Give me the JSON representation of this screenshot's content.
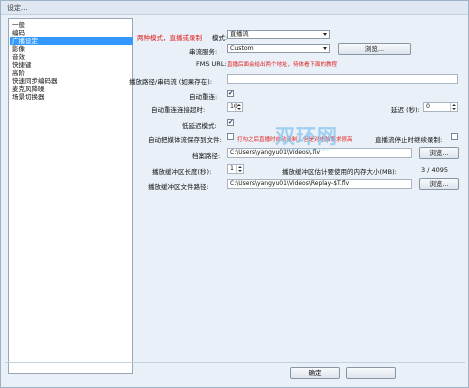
{
  "window": {
    "title": "设定..."
  },
  "sidebar": {
    "items": [
      {
        "label": "一般",
        "selected": false
      },
      {
        "label": "编码",
        "selected": false
      },
      {
        "label": "广播设定",
        "selected": true
      },
      {
        "label": "影像",
        "selected": false
      },
      {
        "label": "音效",
        "selected": false
      },
      {
        "label": "快捷键",
        "selected": false
      },
      {
        "label": "高阶",
        "selected": false
      },
      {
        "label": "快速同步编码器",
        "selected": false
      },
      {
        "label": "麦克风降噪",
        "selected": false
      },
      {
        "label": "场景切换器",
        "selected": false
      }
    ]
  },
  "broadcast": {
    "mode_label": "模式:",
    "mode_note": "两种模式，直播或录制",
    "mode_value": "直播流",
    "service_label": "串流服务:",
    "service_value": "Custom",
    "browse_button": "浏览...",
    "fms_url_label": "FMS URL:",
    "fms_url_note": "直播后面会给出两个地址，待体看下面的教程",
    "fms_url_value": "",
    "stream_key_label": "播放路径/串码流 (如果存在):",
    "stream_key_value": "",
    "auto_reconnect_label": "自动重连:",
    "auto_reconnect_checked": true,
    "reconnect_timeout_label": "自动重连连接超时:",
    "reconnect_timeout_value": "10",
    "delay_label": "延迟 (秒):",
    "delay_value": "0",
    "low_latency_label": "低延迟模式:",
    "low_latency_checked": true,
    "auto_save_label": "自动把媒体流保存到文件:",
    "auto_save_note": "打勾之后直播时自动录制，但是对电脑要求很高",
    "auto_save_checked": false,
    "keep_recording_label": "直播流停止时继续录制:",
    "keep_recording_checked": false,
    "file_path_label": "档案路径:",
    "file_path_value": "C:\\Users\\yangyu01\\Videos\\.flv",
    "browse_button_2": "浏览...",
    "replay_length_label": "播放缓冲区长度(秒):",
    "replay_length_value": "1",
    "replay_memory_label": "播放缓冲区估计要使用的内存大小(MB):",
    "replay_memory_value": "3 / 4095",
    "replay_path_label": "播放缓冲区文件路径:",
    "replay_path_value": "C:\\Users\\yangyu01\\Videos\\Replay-$T.flv",
    "browse_button_3": "浏览..."
  },
  "footer": {
    "ok_button": "确定",
    "cancel_button": ""
  },
  "watermark": {
    "text": "双环网",
    "sub": "www.shuangz.com"
  },
  "colors": {
    "selected": "#3399ff",
    "note_red": "#e02020",
    "watermark": "#86c4f0"
  }
}
